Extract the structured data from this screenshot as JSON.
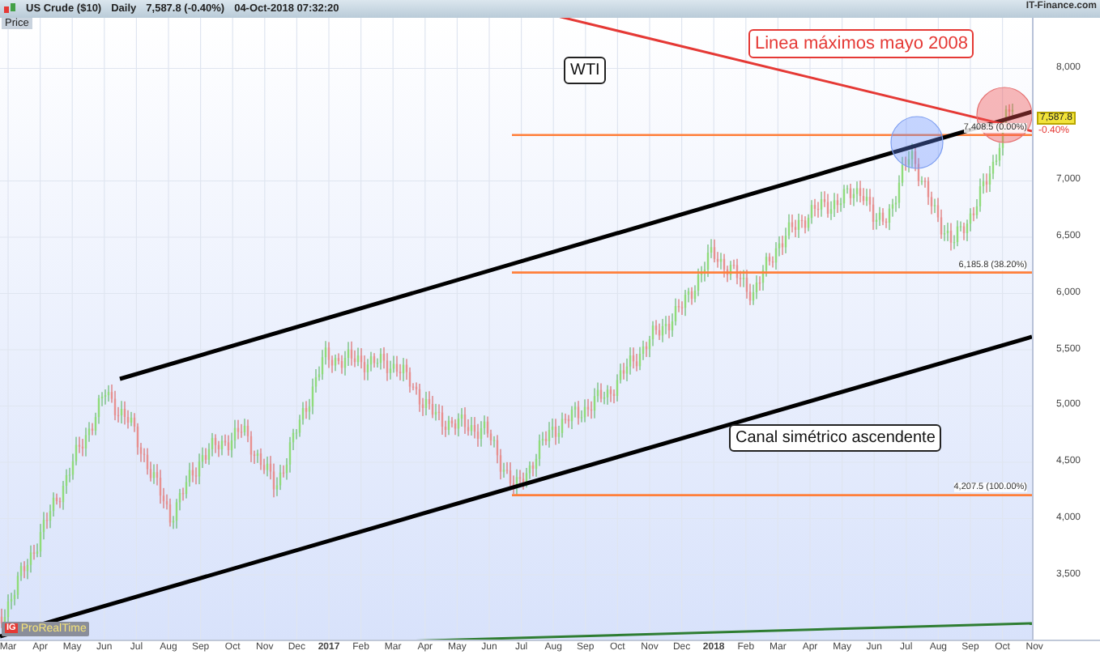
{
  "header": {
    "symbol": "US Crude ($10)",
    "period": "Daily",
    "quote": "7,587.8 (-0.40%)",
    "timestamp": "04-Oct-2018 07:32:20"
  },
  "price_label": "Price",
  "source": "IT-Finance.com",
  "branding": {
    "badge": "IG",
    "name": "ProRealTime"
  },
  "annotations": [
    {
      "text": "WTI",
      "kind": "plain"
    },
    {
      "text": "Linea máximos mayo 2008",
      "kind": "alert"
    },
    {
      "text": "Canal simétrico ascendente",
      "kind": "plain"
    }
  ],
  "levels": [
    {
      "label": "7,408.5 (0.00%)"
    },
    {
      "label": "6,185.8 (38.20%)"
    },
    {
      "label": "4,207.5 (100.00%)"
    }
  ],
  "last_price": {
    "value": "7,587.8",
    "change": "-0.40%"
  },
  "y_axis": [
    "8,000",
    "7,000",
    "6,500",
    "6,000",
    "5,500",
    "5,000",
    "4,500",
    "4,000",
    "3,500"
  ],
  "x_axis": [
    {
      "text": "Mar",
      "kind": "month"
    },
    {
      "text": "Apr",
      "kind": "month"
    },
    {
      "text": "May",
      "kind": "month"
    },
    {
      "text": "Jun",
      "kind": "month"
    },
    {
      "text": "Jul",
      "kind": "month"
    },
    {
      "text": "Aug",
      "kind": "month"
    },
    {
      "text": "Sep",
      "kind": "month"
    },
    {
      "text": "Oct",
      "kind": "month"
    },
    {
      "text": "Nov",
      "kind": "month"
    },
    {
      "text": "Dec",
      "kind": "month"
    },
    {
      "text": "2017",
      "kind": "year"
    },
    {
      "text": "Feb",
      "kind": "month"
    },
    {
      "text": "Mar",
      "kind": "month"
    },
    {
      "text": "Apr",
      "kind": "month"
    },
    {
      "text": "May",
      "kind": "month"
    },
    {
      "text": "Jun",
      "kind": "month"
    },
    {
      "text": "Jul",
      "kind": "month"
    },
    {
      "text": "Aug",
      "kind": "month"
    },
    {
      "text": "Sep",
      "kind": "month"
    },
    {
      "text": "Oct",
      "kind": "month"
    },
    {
      "text": "Nov",
      "kind": "month"
    },
    {
      "text": "Dec",
      "kind": "month"
    },
    {
      "text": "2018",
      "kind": "year"
    },
    {
      "text": "Feb",
      "kind": "month"
    },
    {
      "text": "Mar",
      "kind": "month"
    },
    {
      "text": "Apr",
      "kind": "month"
    },
    {
      "text": "May",
      "kind": "month"
    },
    {
      "text": "Jun",
      "kind": "month"
    },
    {
      "text": "Jul",
      "kind": "month"
    },
    {
      "text": "Aug",
      "kind": "month"
    },
    {
      "text": "Sep",
      "kind": "month"
    },
    {
      "text": "Oct",
      "kind": "month"
    },
    {
      "text": "Nov",
      "kind": "month"
    }
  ]
}
